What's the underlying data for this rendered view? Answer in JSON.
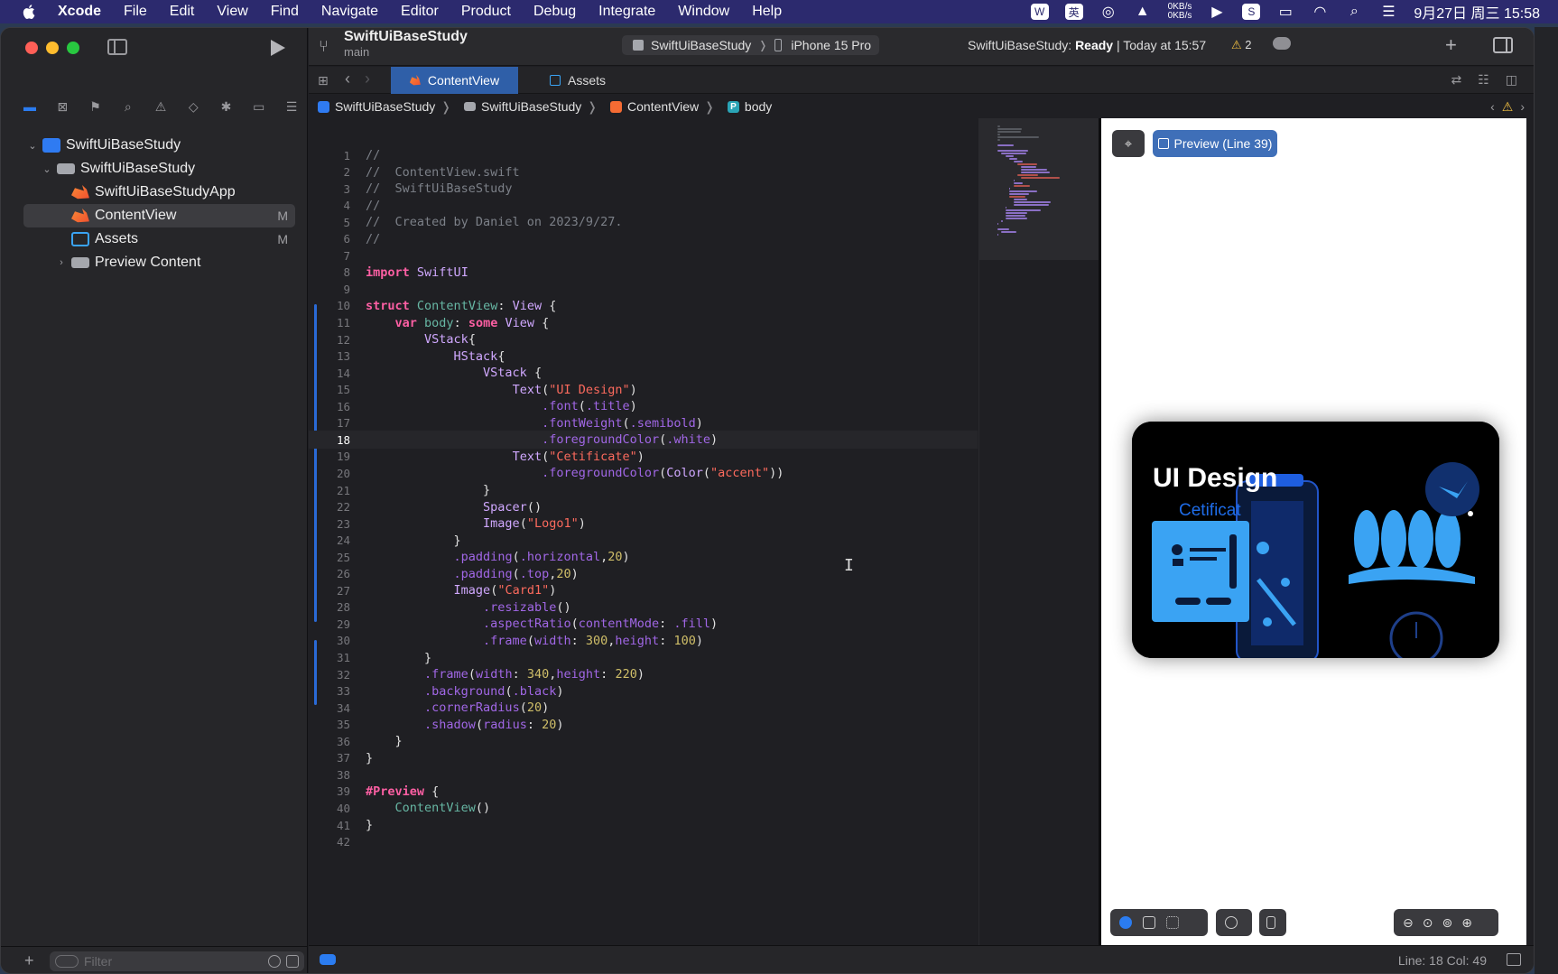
{
  "menubar": {
    "app": "Xcode",
    "items": [
      "File",
      "Edit",
      "View",
      "Find",
      "Navigate",
      "Editor",
      "Product",
      "Debug",
      "Integrate",
      "Window",
      "Help"
    ],
    "net_up": "0KB/s",
    "net_down": "0KB/s",
    "ime_label": "英",
    "datetime": "9月27日 周三 15:58"
  },
  "toolbar": {
    "project": "SwiftUiBaseStudy",
    "branch": "main",
    "scheme": "SwiftUiBaseStudy",
    "device": "iPhone 15 Pro",
    "status_prefix": "SwiftUiBaseStudy: ",
    "status_state": "Ready",
    "status_suffix": " | Today at 15:57",
    "warnings": "2"
  },
  "tabs": [
    {
      "label": "ContentView",
      "active": true
    },
    {
      "label": "Assets",
      "active": false
    }
  ],
  "breadcrumb": [
    "SwiftUiBaseStudy",
    "SwiftUiBaseStudy",
    "ContentView",
    "body"
  ],
  "breadcrumb_body_badge": "P",
  "navigator": {
    "tree": [
      {
        "label": "SwiftUiBaseStudy",
        "kind": "project",
        "badge": ""
      },
      {
        "label": "SwiftUiBaseStudy",
        "kind": "folder",
        "badge": ""
      },
      {
        "label": "SwiftUiBaseStudyApp",
        "kind": "swift",
        "badge": ""
      },
      {
        "label": "ContentView",
        "kind": "swift",
        "badge": "M"
      },
      {
        "label": "Assets",
        "kind": "assets",
        "badge": "M"
      },
      {
        "label": "Preview Content",
        "kind": "folder",
        "badge": ""
      }
    ],
    "filter_placeholder": "Filter"
  },
  "editor": {
    "current_line": 18,
    "lines": [
      "//",
      "//  ContentView.swift",
      "//  SwiftUiBaseStudy",
      "//",
      "//  Created by Daniel on 2023/9/27.",
      "//",
      "",
      "import SwiftUI",
      "",
      "struct ContentView: View {",
      "    var body: some View {",
      "        VStack{",
      "            HStack{",
      "                VStack {",
      "                    Text(\"UI Design\")",
      "                        .font(.title)",
      "                        .fontWeight(.semibold)",
      "                        .foregroundColor(.white)",
      "                    Text(\"Cetificate\")",
      "                        .foregroundColor(Color(\"accent\"))",
      "                }",
      "                Spacer()",
      "                Image(\"Logo1\")",
      "            }",
      "            .padding(.horizontal,20)",
      "            .padding(.top,20)",
      "            Image(\"Card1\")",
      "                .resizable()",
      "                .aspectRatio(contentMode: .fill)",
      "                .frame(width: 300,height: 100)",
      "        }",
      "        .frame(width: 340,height: 220)",
      "        .background(.black)",
      "        .cornerRadius(20)",
      "        .shadow(radius: 20)",
      "    }",
      "}",
      "",
      "#Preview {",
      "    ContentView()",
      "}",
      ""
    ]
  },
  "preview": {
    "pin_label": "⌖",
    "button_label": "Preview (Line 39)",
    "card_title": "UI Design",
    "card_subtitle": "Cetificat"
  },
  "statusbar": {
    "position": "Line: 18  Col: 49"
  },
  "colors": {
    "accent": "#2f5fa8",
    "card_blue": "#3aa3f3"
  }
}
